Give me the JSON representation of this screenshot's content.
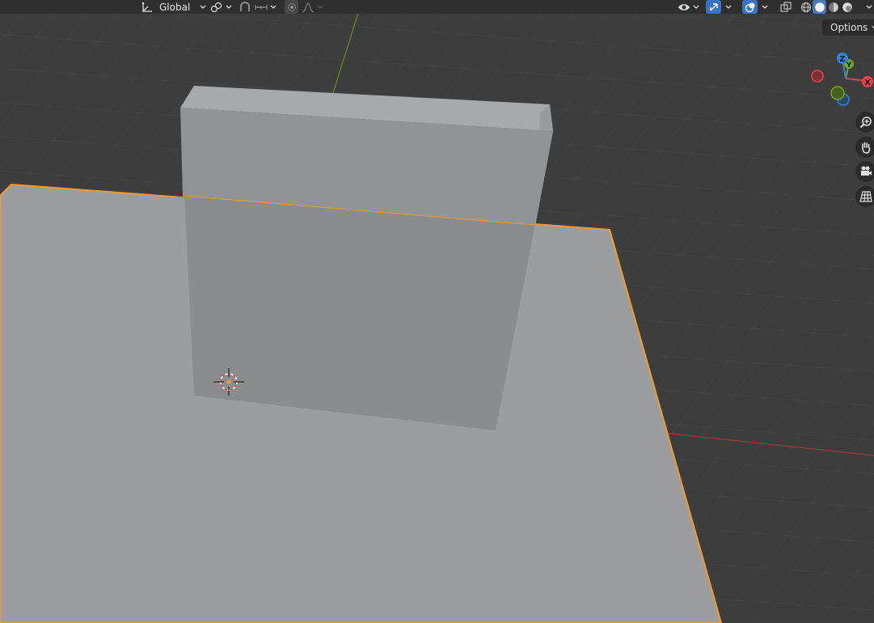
{
  "header": {
    "transform_orientation": "Global",
    "orientation_icon": "transform-orientation-icon",
    "pivot_icon": "pivot-point-icon",
    "snap_icon": "snap-magnet-icon",
    "snap_target_icon": "snap-increment-icon",
    "proportional_icon": "proportional-editing-icon",
    "falloff_icon": "falloff-curve-icon",
    "visibility_icon": "eye-visibility-icon",
    "gizmo_icon": "gizmo-icon",
    "overlay_icon": "overlay-icon",
    "xray_icon": "xray-icon",
    "shading_modes": [
      "wireframe",
      "solid",
      "material-preview",
      "rendered"
    ],
    "active_shading": "solid",
    "options_label": "Options"
  },
  "nav_gizmo": {
    "axes": [
      "X",
      "Y",
      "Z"
    ],
    "colors": {
      "x": "#e8424c",
      "y": "#6ea825",
      "z": "#2f83e0"
    }
  },
  "nav_buttons": [
    "zoom-icon",
    "hand-pan-icon",
    "camera-icon",
    "grid-ortho-icon"
  ],
  "colors": {
    "background": "#3d3d3d",
    "grid": "#494949",
    "selection_outline": "#f29a2e",
    "x_axis": "#9c3c3c",
    "y_axis": "#6e8a2c"
  },
  "scene": {
    "objects": [
      "Plane",
      "Cube"
    ],
    "selected": "Plane"
  }
}
